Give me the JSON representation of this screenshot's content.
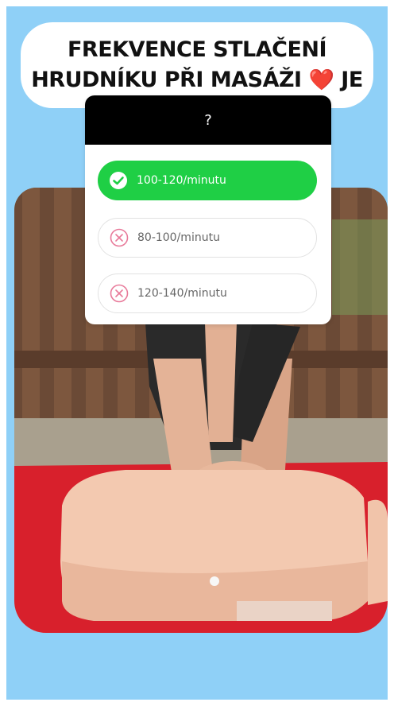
{
  "title": {
    "line1": "FREKVENCE STLAČENÍ",
    "line2_text": "HRUDNÍKU PŘI MASÁŽI",
    "line2_emoji": "❤️",
    "line2_end": "JE"
  },
  "quiz": {
    "question": "?",
    "options": [
      {
        "label": "100-120/minutu",
        "state": "correct",
        "icon": "check-circle-icon"
      },
      {
        "label": "80-100/minutu",
        "state": "wrong",
        "icon": "x-circle-icon"
      },
      {
        "label": "120-140/minutu",
        "state": "wrong",
        "icon": "x-circle-icon"
      }
    ]
  },
  "colors": {
    "background": "#8fd0f7",
    "correct": "#1fcf45",
    "wrong_icon": "#e87a9a",
    "header": "#000000"
  }
}
